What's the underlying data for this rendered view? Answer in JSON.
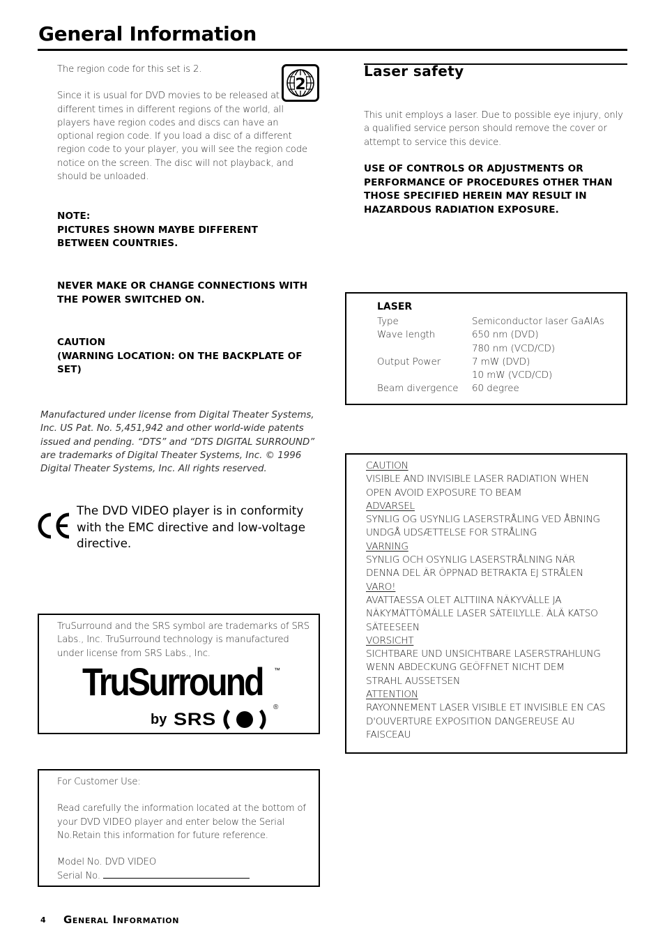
{
  "header": {
    "title": "General Information"
  },
  "region": {
    "icon": "dvd-region-2-globe-icon",
    "region_number": "2",
    "line1": "The region code for this set is 2.",
    "paragraph": "Since it is usual for DVD movies to be released at different times in different regions of the world, all players have region codes and discs can have an optional region code. If you load a disc of a different region code to your player, you will see the region code notice on the screen. The disc will not playback, and should be unloaded."
  },
  "notices": {
    "note_heading": "NOTE:",
    "note_body": "PICTURES SHOWN MAYBE DIFFERENT BETWEEN COUNTRIES.",
    "connections": "NEVER MAKE OR CHANGE CONNECTIONS WITH THE POWER SWITCHED ON.",
    "caution_heading": "CAUTION",
    "caution_body": "(WARNING LOCATION: ON THE BACKPLATE OF SET)"
  },
  "dts": {
    "text": "Manufactured under license from Digital Theater Systems, Inc. US Pat. No. 5,451,942 and other world-wide patents issued and pending. “DTS” and “DTS DIGITAL SURROUND” are trademarks of Digital Theater Systems, Inc. © 1996 Digital Theater Systems, Inc. All rights reserved."
  },
  "ce": {
    "icon": "ce-mark-icon",
    "text": "The DVD VIDEO player is in conformity with the EMC directive and low-voltage directive."
  },
  "srs": {
    "text": "TruSurround and the SRS symbol are trademarks of SRS Labs., Inc. TruSurround technology is manufactured under license from SRS Labs., Inc.",
    "logo_word": "TruSurround",
    "tm": "™",
    "by": "by",
    "srs": "SRS",
    "registered": "®"
  },
  "customer": {
    "heading": "For Customer Use:",
    "paragraph": "Read carefully the information located at the bottom of your DVD VIDEO player and enter below the Serial No.Retain this information for future reference.",
    "model_line": "Model No. DVD VIDEO",
    "serial_label": "Serial No."
  },
  "laser_safety": {
    "title": "Laser safety",
    "intro": "This unit employs a laser. Due to possible eye injury, only a qualified service person should remove the cover or attempt to service this device.",
    "warning": "USE OF CONTROLS OR ADJUSTMENTS OR PERFORMANCE OF PROCEDURES OTHER THAN THOSE SPECIFIED HEREIN MAY RESULT IN HAZARDOUS RADIATION EXPOSURE."
  },
  "laser_spec": {
    "heading": "LASER",
    "rows": [
      {
        "label": "Type",
        "value": "Semiconductor laser GaAIAs"
      },
      {
        "label": "Wave length",
        "value": "650 nm (DVD)"
      },
      {
        "label": "",
        "value": "780 nm (VCD/CD)"
      },
      {
        "label": "Output Power",
        "value": "7 mW (DVD)"
      },
      {
        "label": "",
        "value": "10 mW (VCD/CD)"
      },
      {
        "label": "Beam divergence",
        "value": "60 degree"
      }
    ]
  },
  "multilingual_warnings": [
    {
      "heading": "CAUTION",
      "lines": [
        "VISIBLE AND INVISIBLE LASER RADIATION WHEN",
        "OPEN AVOID EXPOSURE TO BEAM"
      ]
    },
    {
      "heading": "ADVARSEL",
      "lines": [
        "SYNLIG OG USYNLIG LASERSTRÅLING VED ÅBNING",
        "UNDGÅ UDSÆTTELSE FOR STRÅLING"
      ]
    },
    {
      "heading": "VARNING",
      "lines": [
        "SYNLIG OCH OSYNLIG LASERSTRÅLNING NÄR",
        "DENNA DEL ÄR ÖPPNAD BETRAKTA EJ STRÅLEN"
      ]
    },
    {
      "heading": "VARO!",
      "lines": [
        "AVATTAESSA OLET ALTTIINA NÄKYVÄLLE JA",
        "NÄKYMÄTTÖMÄLLE LASER SÄTEILYLLE. ÄLÄ KATSO",
        "SÄTEESEEN"
      ]
    },
    {
      "heading": "VORSICHT",
      "lines": [
        "SICHTBARE UND UNSICHTBARE LASERSTRAHLUNG",
        "WENN ABDECKUNG GEÖFFNET NICHT DEM",
        "STRAHL AUSSETSEN"
      ]
    },
    {
      "heading": "ATTENTION",
      "lines": [
        "RAYONNEMENT LASER VISIBLE ET INVISIBLE EN CAS",
        "D'OUVERTURE EXPOSITION DANGEREUSE AU",
        "FAISCEAU"
      ]
    }
  ],
  "footer": {
    "page_number": "4",
    "section_title": "General Information"
  }
}
